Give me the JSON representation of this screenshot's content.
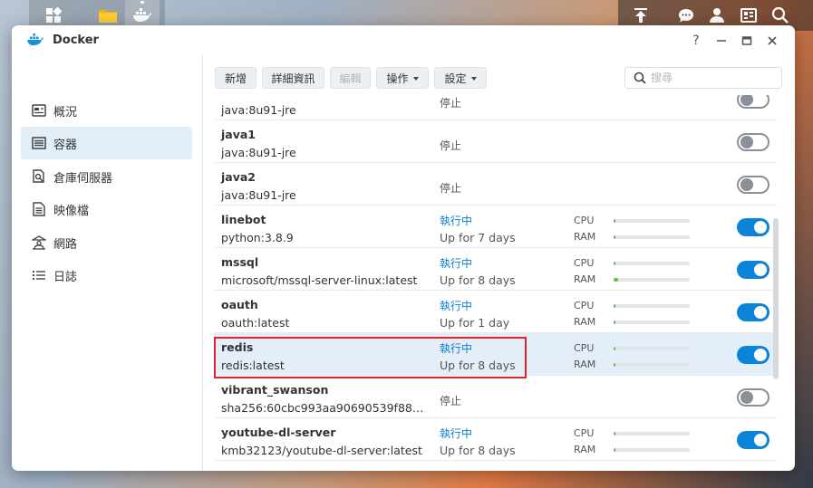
{
  "window": {
    "title": "Docker",
    "help": "?",
    "minimize": "—",
    "maximize": "□",
    "close": "✕"
  },
  "sidebar": {
    "items": [
      {
        "label": "概況"
      },
      {
        "label": "容器"
      },
      {
        "label": "倉庫伺服器"
      },
      {
        "label": "映像檔"
      },
      {
        "label": "網路"
      },
      {
        "label": "日誌"
      }
    ]
  },
  "toolbar": {
    "new_label": "新增",
    "details_label": "詳細資訊",
    "edit_label": "編輯",
    "action_label": "操作",
    "settings_label": "設定"
  },
  "search": {
    "placeholder": "搜尋",
    "value": ""
  },
  "labels": {
    "cpu": "CPU",
    "ram": "RAM"
  },
  "containers": [
    {
      "name": "",
      "image": "java:8u91-jre",
      "status": "停止",
      "running": false,
      "uptime": ""
    },
    {
      "name": "java1",
      "image": "java:8u91-jre",
      "status": "停止",
      "running": false,
      "uptime": ""
    },
    {
      "name": "java2",
      "image": "java:8u91-jre",
      "status": "停止",
      "running": false,
      "uptime": ""
    },
    {
      "name": "linebot",
      "image": "python:3.8.9",
      "status": "執行中",
      "running": true,
      "uptime": "Up for 7 days",
      "cpu": 0.02,
      "ram": 0.02
    },
    {
      "name": "mssql",
      "image": "microsoft/mssql-server-linux:latest",
      "status": "執行中",
      "running": true,
      "uptime": "Up for 8 days",
      "cpu": 0.02,
      "ram": 0.06
    },
    {
      "name": "oauth",
      "image": "oauth:latest",
      "status": "執行中",
      "running": true,
      "uptime": "Up for 1 day",
      "cpu": 0.02,
      "ram": 0.02
    },
    {
      "name": "redis",
      "image": "redis:latest",
      "status": "執行中",
      "running": true,
      "uptime": "Up for 8 days",
      "cpu": 0.01,
      "ram": 0.02
    },
    {
      "name": "vibrant_swanson",
      "image": "sha256:60cbc993aa90690539f8839c...",
      "status": "停止",
      "running": false,
      "uptime": ""
    },
    {
      "name": "youtube-dl-server",
      "image": "kmb32123/youtube-dl-server:latest",
      "status": "執行中",
      "running": true,
      "uptime": "Up for 8 days",
      "cpu": 0.02,
      "ram": 0.02
    }
  ],
  "colors": {
    "accent": "#0a84d8",
    "running_text": "#0a7fd0",
    "bar_fill": "#5fbf2f",
    "highlight": "#e0262a"
  }
}
